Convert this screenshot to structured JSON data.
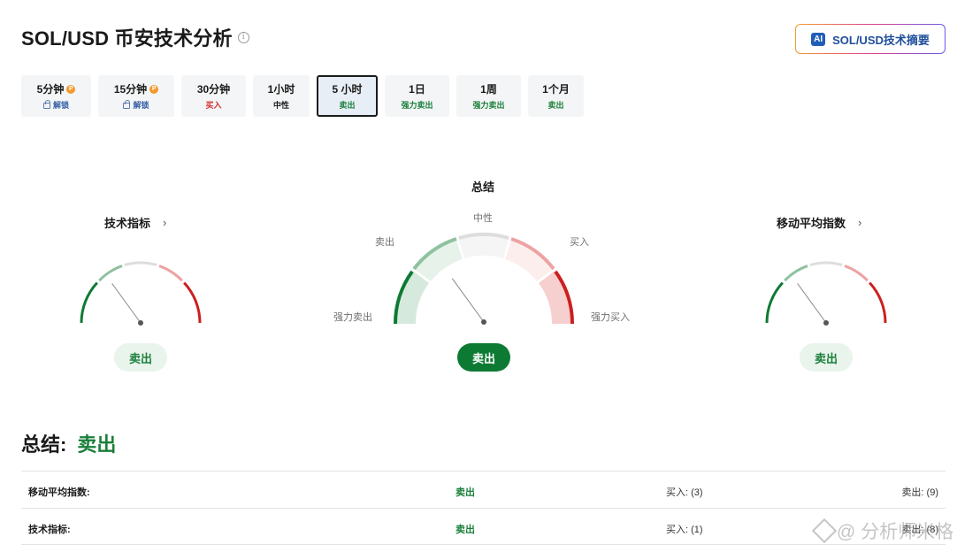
{
  "header": {
    "title": "SOL/USD 币安技术分析",
    "ai_badge": "AI",
    "ai_button_label": "SOL/USD技术摘要"
  },
  "tabs": [
    {
      "label": "5分钟",
      "pro": "P",
      "status": "解锁",
      "status_type": "unlock",
      "active": false
    },
    {
      "label": "15分钟",
      "pro": "P",
      "status": "解锁",
      "status_type": "unlock",
      "active": false
    },
    {
      "label": "30分钟",
      "status": "买入",
      "status_type": "buy",
      "active": false
    },
    {
      "label": "1小时",
      "status": "中性",
      "status_type": "neutral",
      "active": false
    },
    {
      "label": "5 小时",
      "status": "卖出",
      "status_type": "sell",
      "active": true
    },
    {
      "label": "1日",
      "status": "强力卖出",
      "status_type": "sell",
      "active": false
    },
    {
      "label": "1周",
      "status": "强力卖出",
      "status_type": "sell",
      "active": false
    },
    {
      "label": "1个月",
      "status": "卖出",
      "status_type": "sell",
      "active": false
    }
  ],
  "gauges": {
    "technical": {
      "title": "技术指标",
      "chevron": "›",
      "result": "卖出",
      "needle_fraction": 0.3
    },
    "summary": {
      "title": "总结",
      "result": "卖出",
      "needle_fraction": 0.3,
      "labels": {
        "strong_sell": "强力卖出",
        "sell": "卖出",
        "neutral": "中性",
        "buy": "买入",
        "strong_buy": "强力买入"
      }
    },
    "moving_avg": {
      "title": "移动平均指数",
      "chevron": "›",
      "result": "卖出",
      "needle_fraction": 0.3
    }
  },
  "summary": {
    "label": "总结:",
    "value": "卖出",
    "rows": [
      {
        "name": "移动平均指数:",
        "signal": "卖出",
        "buy": "买入: (3)",
        "sell": "卖出: (9)"
      },
      {
        "name": "技术指标:",
        "signal": "卖出",
        "buy": "买入: (1)",
        "sell": "卖出: (8)"
      }
    ]
  },
  "watermark": "@ 分析师米格",
  "colors": {
    "sell_green": "#1a7f3a",
    "strong_sell_green": "#0d7a33",
    "buy_red": "#d12f2f",
    "neutral_gray": "#d9d9d9",
    "brand_blue": "#1f4f9a"
  }
}
